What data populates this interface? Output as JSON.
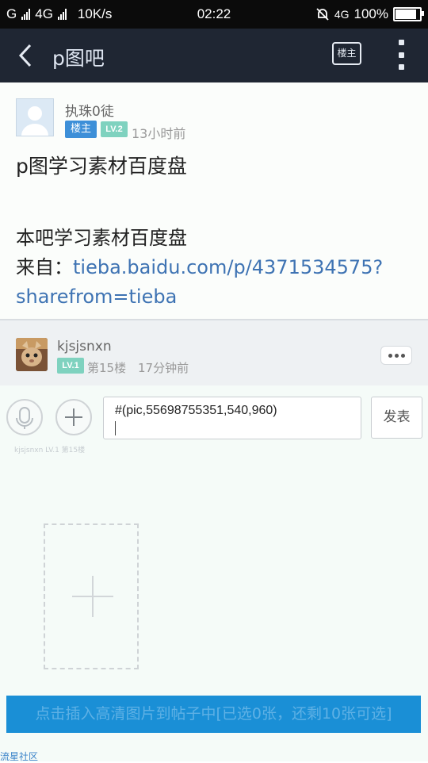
{
  "status_bar": {
    "network_left": "G",
    "network_mid": "4G",
    "speed": "10K/s",
    "time": "02:22",
    "network_right": "4G",
    "battery": "100%",
    "battery_level": 1.0
  },
  "nav": {
    "title": "p图吧",
    "louzhu_button": "楼主"
  },
  "post1": {
    "username": "执珠0徒",
    "role_badge": "楼主",
    "level_badge": "LV.2",
    "time": "13小时前",
    "title": "p图学习素材百度盘",
    "body_line1": "本吧学习素材百度盘",
    "from_label": "来自：",
    "link_part1": "tieba.baidu.com/p/4371534575?",
    "link_part2": "sharefrom=tieba"
  },
  "post2": {
    "username": "kjsjsnxn",
    "level_badge": "LV.1",
    "floor": "第15楼",
    "time": "17分钟前"
  },
  "composer": {
    "input_value": "#(pic,55698755351,540,960)",
    "send_label": "发表",
    "ghost_text": "kjsjsnxn  LV.1 第15楼",
    "insert_bar_label": "点击插入高清图片到帖子中[已选0张，还剩10张可选]"
  },
  "watermark": "流星社区",
  "colors": {
    "nav_bg": "#1f2633",
    "link": "#3e73b3",
    "louzhu_badge": "#3d8fd8",
    "level_badge": "#7fd2bf",
    "insert_bar": "#1a8fd6"
  }
}
